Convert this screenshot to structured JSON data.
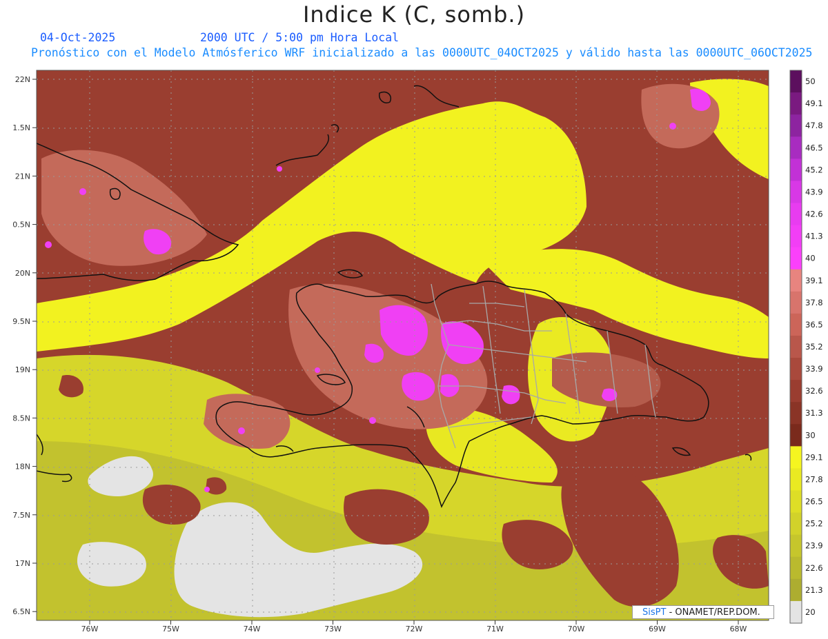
{
  "header": {
    "title": "Indice K (C, somb.)",
    "date": "04-Oct-2025",
    "time": "2000 UTC / 5:00 pm Hora Local",
    "subtitle": "Pronóstico con el Modelo Atmósferico WRF inicializado a las 0000UTC_04OCT2025 y válido hasta las  0000UTC_06OCT2025"
  },
  "axes": {
    "lat_labels": [
      "22N",
      "1.5N",
      "21N",
      "0.5N",
      "20N",
      "9.5N",
      "19N",
      "8.5N",
      "18N",
      "7.5N",
      "17N",
      "6.5N"
    ],
    "lon_labels": [
      "76W",
      "75W",
      "74W",
      "73W",
      "72W",
      "71W",
      "70W",
      "69W",
      "68W"
    ]
  },
  "colorbar": {
    "labels": [
      "50",
      "49.1",
      "47.8",
      "46.5",
      "45.2",
      "43.9",
      "42.6",
      "41.3",
      "40",
      "39.1",
      "37.8",
      "36.5",
      "35.2",
      "33.9",
      "32.6",
      "31.3",
      "30",
      "29.1",
      "27.8",
      "26.5",
      "25.2",
      "23.9",
      "22.6",
      "21.3",
      "20"
    ],
    "colors": [
      "#5c0f5e",
      "#7a1a80",
      "#8d24a0",
      "#a82cc0",
      "#c231d6",
      "#d838e6",
      "#e83cf0",
      "#f23ef6",
      "#fb40fb",
      "#e8847f",
      "#d8746c",
      "#cc6559",
      "#b9574b",
      "#a9493c",
      "#9a3d30",
      "#8a3426",
      "#7a2a1c",
      "#f5f520",
      "#eaea22",
      "#dede26",
      "#d2d22a",
      "#c6c62c",
      "#baba2e",
      "#adad30",
      "#e4e4e4"
    ]
  },
  "credit": {
    "brand": "SisPT",
    "org": "- ONAMET/REP.DOM."
  }
}
